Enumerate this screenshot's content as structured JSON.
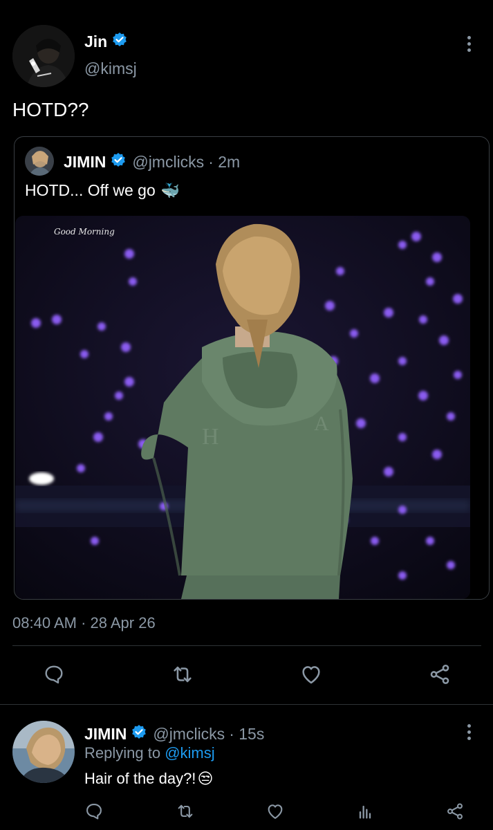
{
  "main_tweet": {
    "author_name": "Jin",
    "author_handle": "@kimsj",
    "text": "HOTD??",
    "timestamp": "08:40 AM · 28 Apr 26"
  },
  "quoted_tweet": {
    "author_name": "JIMIN",
    "author_handle": "@jmclicks",
    "time_ago": "· 2m",
    "text": "HOTD... Off we go",
    "emoji": "🐳",
    "photo_caption": "Good Morning"
  },
  "reply": {
    "author_name": "JIMIN",
    "author_handle": "@jmclicks",
    "time_ago": "· 15s",
    "replying_prefix": "Replying to",
    "replying_to": "@kimsj",
    "text": "Hair of the day?!",
    "emoji": "😒"
  },
  "icons": {
    "reply": "comment-icon",
    "retweet": "retweet-icon",
    "like": "heart-icon",
    "share": "share-icon",
    "analytics": "analytics-icon",
    "verified": "verified-badge-icon",
    "more": "more-options-icon"
  },
  "colors": {
    "background": "#000000",
    "accent": "#1d9bf0",
    "secondary_text": "#8b98a5",
    "divider": "#2f3336"
  }
}
